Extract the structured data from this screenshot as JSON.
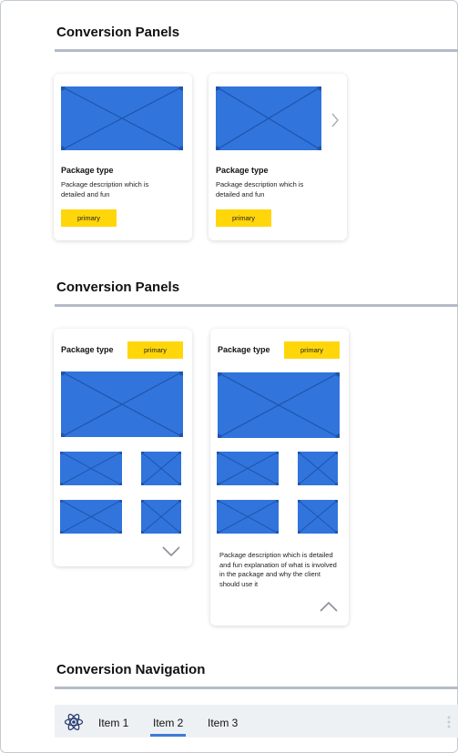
{
  "sections": [
    {
      "title": "Conversion Panels"
    },
    {
      "title": "Conversion Panels"
    },
    {
      "title": "Conversion Navigation"
    }
  ],
  "panels_row1": [
    {
      "type": "Package type",
      "description": "Package description which is detailed and fun",
      "button": "primary"
    },
    {
      "type": "Package type",
      "description": "Package description which is detailed and fun",
      "button": "primary"
    }
  ],
  "panels_row2": [
    {
      "type": "Package type",
      "button": "primary"
    },
    {
      "type": "Package type",
      "button": "primary",
      "description": "Package description which is detailed and fun explanation of what is involved in the package and why the client should use it"
    }
  ],
  "navigation": {
    "items": [
      "Item 1",
      "Item 2",
      "Item 3"
    ],
    "active_index": 1
  },
  "colors": {
    "placeholder": "#3174dc",
    "placeholder_line": "#1f55ad",
    "primary_button": "#ffd60a",
    "rule": "#b4bcc8",
    "nav_bg": "#eef1f4",
    "nav_active": "#3d7bd9"
  },
  "icons": {
    "next": "chevron-right-icon",
    "expand": "chevron-down-icon",
    "collapse": "chevron-up-icon",
    "logo": "atom-icon",
    "more": "vertical-dots-icon"
  }
}
